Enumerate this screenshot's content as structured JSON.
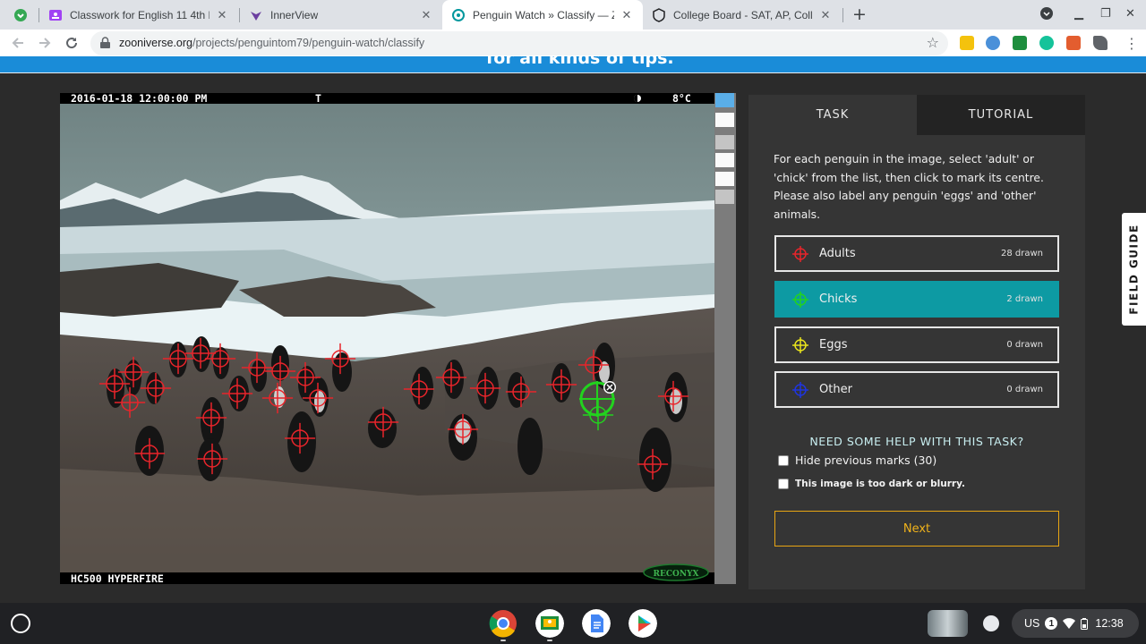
{
  "browser": {
    "tabs": [
      {
        "title": "Classwork for English 11 4th Blo",
        "icon": "google-classroom-icon"
      },
      {
        "title": "InnerView",
        "icon": "innerview-icon"
      },
      {
        "title": "Penguin Watch » Classify — Zoo",
        "icon": "zooniverse-icon",
        "active": true
      },
      {
        "title": "College Board - SAT, AP, College",
        "icon": "college-board-icon"
      }
    ],
    "new_tab": "+",
    "url_host": "zooniverse.org",
    "url_path": "/projects/penguintom79/penguin-watch/classify"
  },
  "banner": {
    "text": "for all kinds of tips."
  },
  "camera": {
    "timestamp": "2016-01-18 12:00:00 PM",
    "flag": "T",
    "temperature": "8°C",
    "model": "HC500 HYPERFIRE",
    "brand": "RECONYX"
  },
  "task": {
    "tab_task": "TASK",
    "tab_tutorial": "TUTORIAL",
    "instructions": "For each penguin in the image, select 'adult' or 'chick' from the list, then click to mark its centre. Please also label any penguin 'eggs' and 'other' animals.",
    "tools": [
      {
        "label": "Adults",
        "count": "28 drawn",
        "color": "#e8252b"
      },
      {
        "label": "Chicks",
        "count": "2 drawn",
        "color": "#22d31e",
        "active": true
      },
      {
        "label": "Eggs",
        "count": "0 drawn",
        "color": "#e9e41c"
      },
      {
        "label": "Other",
        "count": "0 drawn",
        "color": "#1f35e0"
      }
    ],
    "help": "NEED SOME HELP WITH THIS TASK?",
    "hide_marks": "Hide previous marks (30)",
    "too_dark": "This image is too dark or blurry.",
    "next": "Next"
  },
  "field_guide": "FIELD GUIDE",
  "shelf": {
    "apps": [
      "chrome-icon",
      "google-classroom-icon",
      "google-docs-icon",
      "google-play-icon"
    ],
    "locale": "US",
    "notification_count": "1",
    "time": "12:38"
  },
  "colors": {
    "accent": "#0d9aa3",
    "next": "#f0b21b",
    "banner": "#1a8cd8"
  }
}
